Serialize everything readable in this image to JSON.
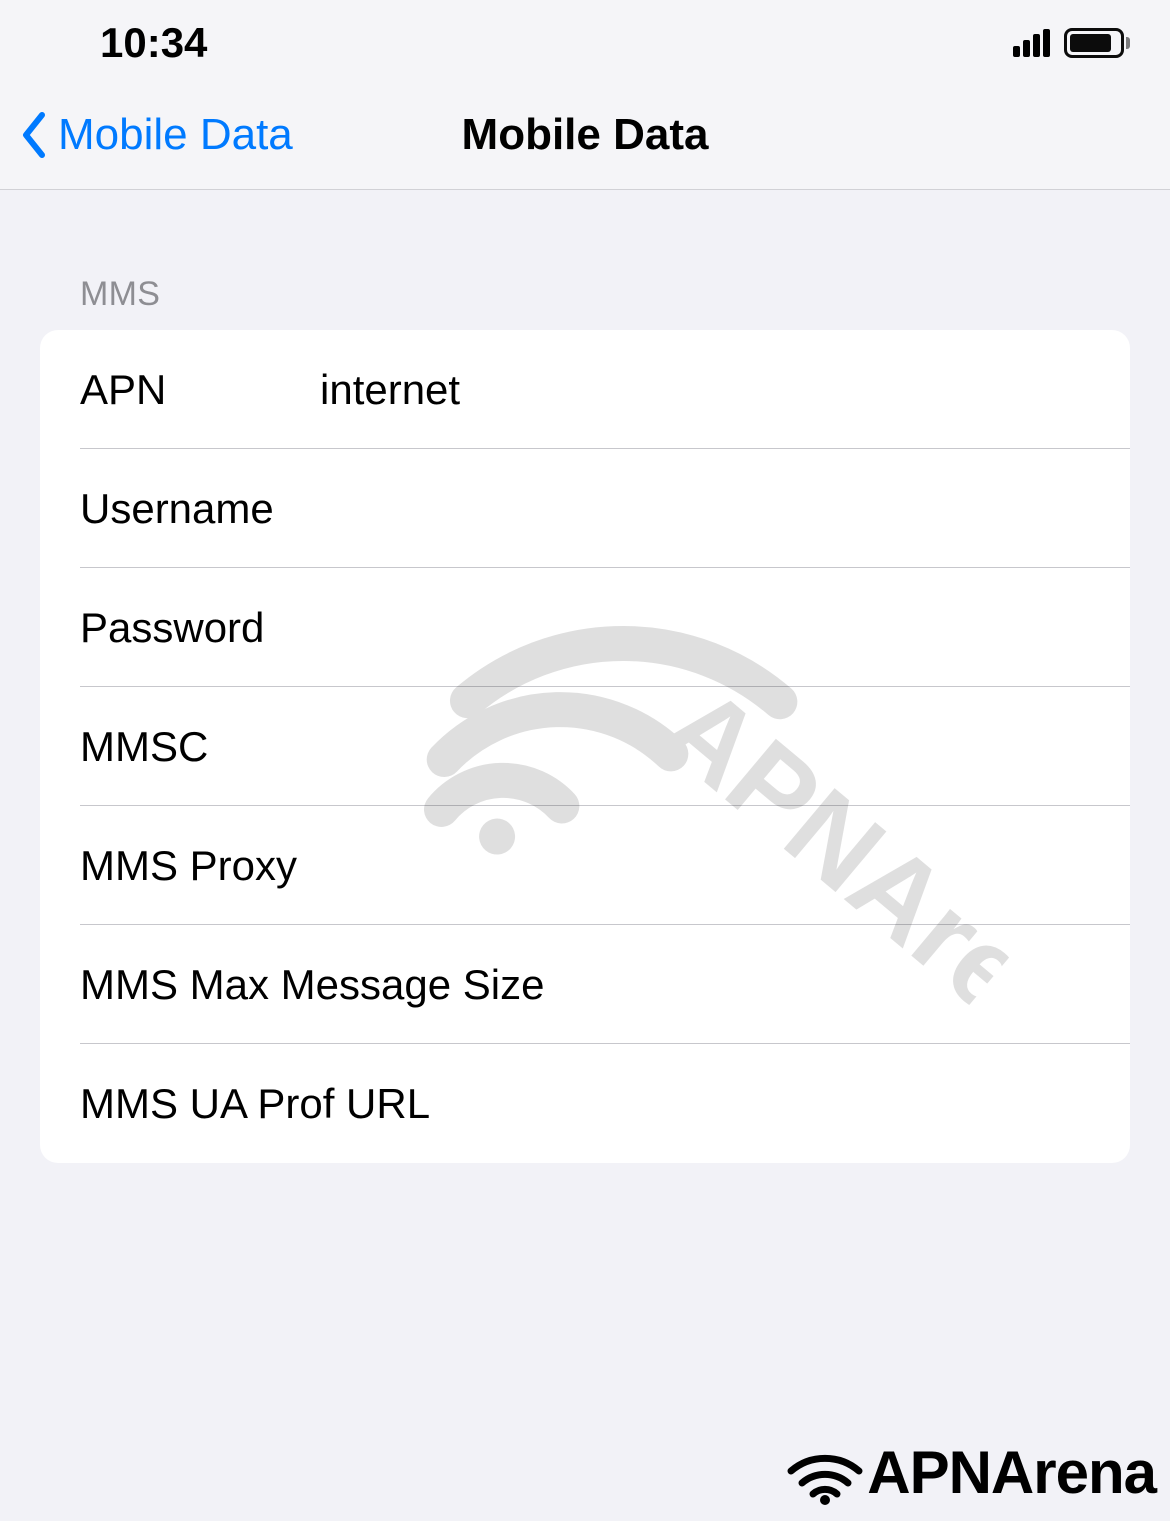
{
  "statusBar": {
    "time": "10:34"
  },
  "header": {
    "backLabel": "Mobile Data",
    "title": "Mobile Data"
  },
  "section": {
    "title": "MMS",
    "fields": {
      "apn": {
        "label": "APN",
        "value": "internet"
      },
      "username": {
        "label": "Username",
        "value": ""
      },
      "password": {
        "label": "Password",
        "value": ""
      },
      "mmsc": {
        "label": "MMSC",
        "value": ""
      },
      "mmsProxy": {
        "label": "MMS Proxy",
        "value": ""
      },
      "mmsMaxSize": {
        "label": "MMS Max Message Size",
        "value": ""
      },
      "mmsUaProf": {
        "label": "MMS UA Prof URL",
        "value": ""
      }
    }
  },
  "watermark": {
    "text": "APNArena"
  },
  "brand": {
    "name": "APNArena"
  }
}
